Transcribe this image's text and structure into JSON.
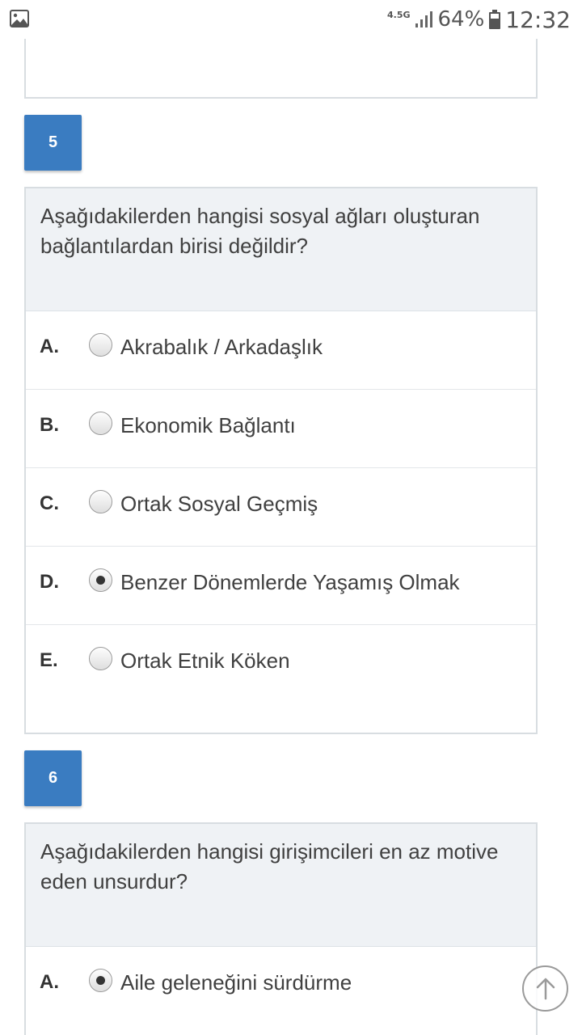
{
  "status_bar": {
    "network": "4.5G",
    "battery_percent": "64%",
    "time": "12:32",
    "icons": [
      "gallery-icon",
      "signal-icon",
      "battery-icon"
    ]
  },
  "questions": [
    {
      "number": "5",
      "text": "Aşağıdakilerden hangisi sosyal ağları oluşturan bağlantılardan birisi değildir?",
      "options": [
        {
          "letter": "A.",
          "text": "Akrabalık / Arkadaşlık",
          "selected": false
        },
        {
          "letter": "B.",
          "text": "Ekonomik Bağlantı",
          "selected": false
        },
        {
          "letter": "C.",
          "text": "Ortak Sosyal Geçmiş",
          "selected": false
        },
        {
          "letter": "D.",
          "text": "Benzer Dönemlerde Yaşamış Olmak",
          "selected": true
        },
        {
          "letter": "E.",
          "text": "Ortak Etnik Köken",
          "selected": false
        }
      ]
    },
    {
      "number": "6",
      "text": "Aşağıdakilerden hangisi girişimcileri en az motive eden unsurdur?",
      "options": [
        {
          "letter": "A.",
          "text": "Aile geleneğini sürdürme",
          "selected": true
        }
      ]
    }
  ],
  "colors": {
    "accent": "#3a7cc1",
    "question_bg": "#eff2f5",
    "border": "#d8dde1"
  },
  "scroll_top_icon": "arrow-up-icon"
}
